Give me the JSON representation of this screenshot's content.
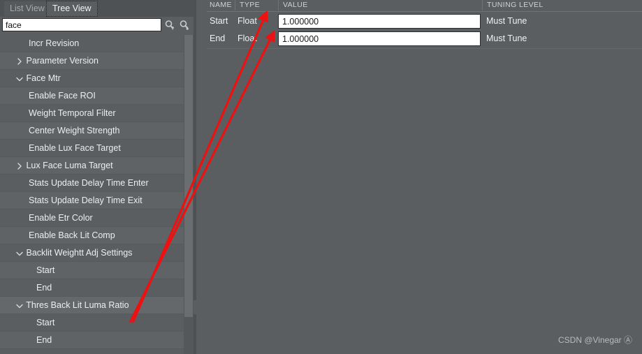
{
  "tabs": {
    "list_view": "List View",
    "tree_view": "Tree View"
  },
  "search": {
    "value": "face",
    "placeholder": "",
    "find_prev_icon": "search-up-icon",
    "find_next_icon": "search-down-icon"
  },
  "tree": {
    "items": [
      {
        "label": "Incr Revision",
        "indent": 2,
        "expander": "none",
        "selected": false
      },
      {
        "label": "Parameter Version",
        "indent": 1,
        "expander": "collapsed",
        "selected": false
      },
      {
        "label": "Face Mtr",
        "indent": 1,
        "expander": "expanded",
        "selected": false
      },
      {
        "label": "Enable Face ROI",
        "indent": 2,
        "expander": "none",
        "selected": false
      },
      {
        "label": "Weight Temporal Filter",
        "indent": 2,
        "expander": "none",
        "selected": false
      },
      {
        "label": "Center Weight Strength",
        "indent": 2,
        "expander": "none",
        "selected": false
      },
      {
        "label": "Enable Lux Face Target",
        "indent": 2,
        "expander": "none",
        "selected": false
      },
      {
        "label": "Lux Face Luma Target",
        "indent": 1,
        "expander": "collapsed",
        "selected": false
      },
      {
        "label": "Stats Update Delay Time Enter",
        "indent": 2,
        "expander": "none",
        "selected": false
      },
      {
        "label": "Stats Update Delay Time Exit",
        "indent": 2,
        "expander": "none",
        "selected": false
      },
      {
        "label": "Enable Etr Color",
        "indent": 2,
        "expander": "none",
        "selected": false
      },
      {
        "label": "Enable Back Lit Comp",
        "indent": 2,
        "expander": "none",
        "selected": false
      },
      {
        "label": "Backlit Weightt Adj Settings",
        "indent": 1,
        "expander": "expanded",
        "selected": false
      },
      {
        "label": "Start",
        "indent": 3,
        "expander": "none",
        "selected": false
      },
      {
        "label": "End",
        "indent": 3,
        "expander": "none",
        "selected": false
      },
      {
        "label": "Thres Back Lit Luma Ratio",
        "indent": 1,
        "expander": "expanded",
        "selected": true
      },
      {
        "label": "Start",
        "indent": 3,
        "expander": "none",
        "selected": false
      },
      {
        "label": "End",
        "indent": 3,
        "expander": "none",
        "selected": false
      }
    ]
  },
  "grid": {
    "headers": {
      "name": "NAME",
      "type": "TYPE",
      "value": "VALUE",
      "tuning_level": "TUNING LEVEL"
    },
    "rows": [
      {
        "name": "Start",
        "type": "Float",
        "value": "1.000000",
        "tuning_level": "Must Tune"
      },
      {
        "name": "End",
        "type": "Float",
        "value": "1.000000",
        "tuning_level": "Must Tune"
      }
    ]
  },
  "watermark": {
    "text": "CSDN @Vinegar Ⓐ"
  },
  "colors": {
    "panel_bg": "#5a5e61",
    "row_alt": "#5f6366",
    "row_selected": "#64686b",
    "input_bg": "#ffffff",
    "annotation": "#ee1111"
  }
}
